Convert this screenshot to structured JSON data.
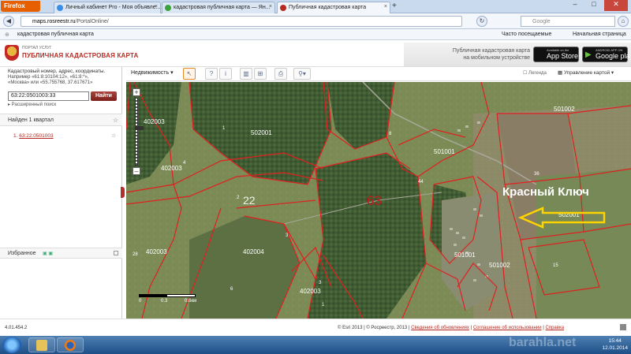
{
  "browser": {
    "menu_label": "Firefox",
    "tabs": [
      {
        "label": "Личный кабинет Pro - Моя объявле...",
        "active": false
      },
      {
        "label": "кадастровая публичная карта — Ян...",
        "active": false
      },
      {
        "label": "Публичная кадастровая карта",
        "active": true
      }
    ],
    "url_domain": "maps.rosreestr.ru",
    "url_path": "/PortalOnline/",
    "search_placeholder": "Google",
    "bookmarks_left": "кадастровая публичная карта",
    "bookmark_frequent": "Часто посещаемые",
    "bookmark_home": "Начальная страница"
  },
  "site": {
    "portal_small": "ПОРТАЛ УСЛУГ",
    "portal_title": "ПУБЛИЧНАЯ КАДАСТРОВАЯ КАРТА",
    "mobile_line1": "Публичная кадастровая карта",
    "mobile_line2": "на мобильном устройстве",
    "appstore_small": "Available on the",
    "appstore_big": "App Store",
    "googleplay_small": "ANDROID APP ON",
    "googleplay_big": "Google play"
  },
  "search": {
    "hint_title": "Кадастровый номер, адрес, координаты.",
    "hint_line2": "Например «61:8:10104:12», «61:8:*»,",
    "hint_line3": "«Москва» или «55.755768, 37.617671»",
    "value": "63:22:0501003:33",
    "button": "Найти",
    "advanced": "▸ Расширенный поиск"
  },
  "results": {
    "found": "Найден 1 квартал",
    "item_number": "1.",
    "item_label": "63:22:0501003"
  },
  "favorites": {
    "label": "Избранное"
  },
  "toolbar": {
    "layer": "Недвижимость",
    "legend": "Легенда",
    "map_control": "Управление картой"
  },
  "map": {
    "region_label": "63",
    "district_label": "22",
    "village_label": "Красный Ключ",
    "zoom_label": "10",
    "parcels": [
      "502001",
      "402003",
      "402003",
      "501001",
      "501002",
      "501002",
      "402003",
      "501001",
      "402004",
      "402003",
      "502001"
    ],
    "small_numbers": [
      "1",
      "2",
      "3",
      "3",
      "6",
      "8",
      "15",
      "36",
      "44",
      "28",
      "4",
      "1"
    ],
    "scale_0": "0",
    "scale_1": "0.3",
    "scale_2": "0.6км",
    "arrow_color": "#ffd400",
    "boundary_color": "#e02020"
  },
  "footer": {
    "version": "4.01.454.2",
    "copyright": "© Esri 2013 | © Росреестр, 2013 |",
    "link_updates": "Сведения об обновлениях",
    "link_terms": "Соглашение об использовании",
    "link_help": "Справка"
  },
  "taskbar": {
    "time": "15:44",
    "date": "12.01.2014",
    "watermark": "barahla.net"
  }
}
